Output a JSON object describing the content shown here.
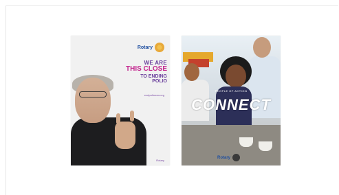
{
  "posters": [
    {
      "logo": "Rotary",
      "headline": [
        "WE ARE",
        "THIS CLOSE",
        "TO ENDING",
        "POLIO"
      ],
      "url": "endpolionow.org",
      "footer": "Rotary"
    },
    {
      "tagline": "PEOPLE OF ACTION",
      "title": "CONNECT",
      "brand": "Rotary"
    }
  ],
  "colors": {
    "rotary_blue": "#1f4fa0",
    "rotary_gold": "#f2c14e",
    "headline_purple": "#6a3f9c",
    "headline_magenta": "#c3278f"
  }
}
